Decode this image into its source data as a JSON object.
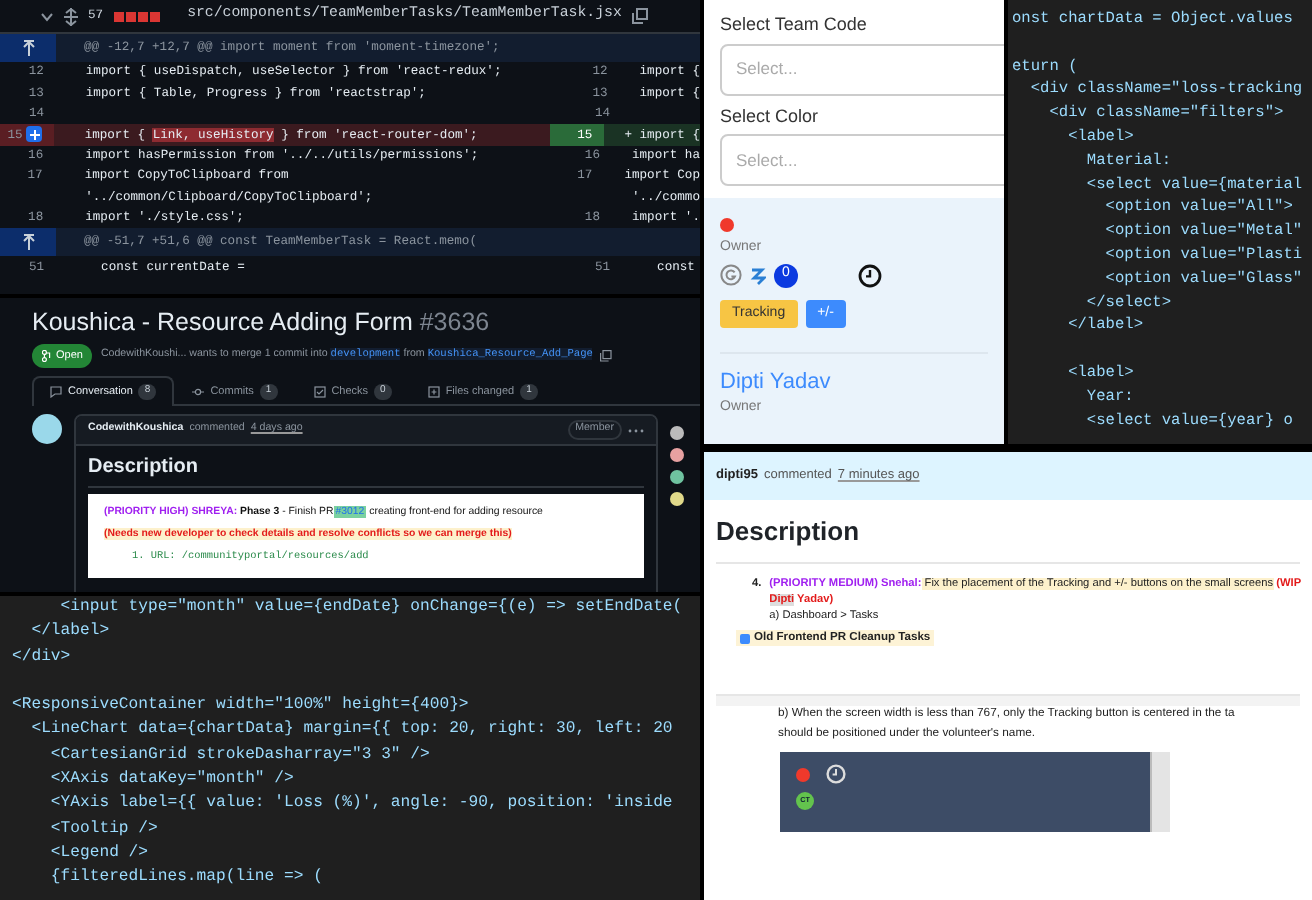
{
  "diff_panel": {
    "file": {
      "changes": "57",
      "path": "src/components/TeamMemberTasks/TeamMemberTask.jsx"
    },
    "rows": [
      {
        "kind": "hunk",
        "text": "@@ -12,7 +12,7 @@ import moment from 'moment-timezone';"
      },
      {
        "kind": "context",
        "left_num": "12",
        "left_code": "import { useDispatch, useSelector } from 'react-redux';",
        "right_num": "12",
        "right_code": "import {"
      },
      {
        "kind": "context",
        "left_num": "13",
        "left_code": "import { Table, Progress } from 'reactstrap';",
        "right_num": "13",
        "right_code": "import {"
      },
      {
        "kind": "context",
        "left_num": "14",
        "right_num": "14"
      },
      {
        "kind": "change",
        "left_num": "15",
        "left_segments": [
          {
            "text": "import { ",
            "removed": false
          },
          {
            "text": "Link, useHistory",
            "removed": true
          },
          {
            "text": " } from 'react-router-dom';",
            "removed": false
          }
        ],
        "right_num": "15",
        "right_code": "+ import {"
      },
      {
        "kind": "context",
        "left_num": "16",
        "left_code": "import hasPermission from '../../utils/permissions';",
        "right_num": "16",
        "right_code": "import ha"
      },
      {
        "kind": "context",
        "left_num": "17",
        "left_code": "import CopyToClipboard from",
        "right_num": "17",
        "right_code": "import Cop"
      },
      {
        "kind": "context",
        "left_code": "'../common/Clipboard/CopyToClipboard';",
        "right_code": "'../commo"
      },
      {
        "kind": "context",
        "left_num": "18",
        "left_code": "import './style.css';",
        "right_num": "18",
        "right_code": "import '."
      },
      {
        "kind": "hunk",
        "text": "@@ -51,7 +51,6 @@ const TeamMemberTask = React.memo("
      },
      {
        "kind": "context",
        "left_num": "51",
        "left_code": "  const currentDate =",
        "right_num": "51",
        "right_code": "  const"
      }
    ]
  },
  "pr_panel": {
    "title": "Koushica - Resource Adding Form",
    "number": "#3636",
    "state": "Open",
    "meta": [
      {
        "text": "CodewithKoushi... wants to merge 1 commit into ",
        "kind": "plain"
      },
      {
        "text": "development",
        "kind": "branch"
      },
      {
        "text": " from ",
        "kind": "plain"
      },
      {
        "text": "Koushica_Resource_Add_Page",
        "kind": "branch"
      }
    ],
    "tabs": [
      {
        "label": "Conversation",
        "count": "8",
        "selected": true
      },
      {
        "label": "Commits",
        "count": "1",
        "selected": false
      },
      {
        "label": "Checks",
        "count": "0",
        "selected": false
      },
      {
        "label": "Files changed",
        "count": "1",
        "selected": false
      }
    ],
    "comment": {
      "author": "CodewithKoushica",
      "action": "commented",
      "time": "4 days ago",
      "role": "Member",
      "heading": "Description",
      "lines": [
        {
          "kind": "paragraph",
          "segments": [
            {
              "text": "(PRIORITY HIGH) SHREYA:",
              "kind": "tag"
            },
            {
              "text": " Phase 3",
              "kind": "bold"
            },
            {
              "text": " - Finish PR",
              "kind": "plain"
            },
            {
              "text": "#3012",
              "kind": "link"
            },
            {
              "text": " creating front-end for adding resource",
              "kind": "plain"
            }
          ]
        },
        {
          "kind": "paragraph",
          "segments": [
            {
              "text": "(Needs new developer to check details and resolve conflicts so we can merge this)",
              "kind": "note"
            }
          ]
        },
        {
          "kind": "url",
          "number": "1.",
          "text": "URL: /communityportal/resources/add"
        }
      ]
    }
  },
  "code_panel": {
    "lines": [
      {
        "kind": "code",
        "text": "     <input type=\"month\" value={endDate} onChange={(e) => setEndDate("
      },
      {
        "kind": "code",
        "text": "  </label>"
      },
      {
        "kind": "code",
        "text": "</div>"
      },
      {
        "kind": "blank"
      },
      {
        "kind": "code",
        "text": "<ResponsiveContainer width=\"100%\" height={400}>"
      },
      {
        "kind": "code",
        "text": "  <LineChart data={chartData} margin={{ top: 20, right: 30, left: 20"
      },
      {
        "kind": "code",
        "text": "    <CartesianGrid strokeDasharray=\"3 3\" />"
      },
      {
        "kind": "code",
        "text": "    <XAxis dataKey=\"month\" />"
      },
      {
        "kind": "code",
        "text": "    <YAxis label={{ value: 'Loss (%)', angle: -90, position: 'inside"
      },
      {
        "kind": "code",
        "text": "    <Tooltip />"
      },
      {
        "kind": "code",
        "text": "    <Legend />"
      },
      {
        "kind": "code",
        "text": "    {filteredLines.map(line => ("
      }
    ]
  },
  "form_panel": {
    "fields": [
      {
        "label": "Select Team Code",
        "placeholder": "Select..."
      },
      {
        "label": "Select Color",
        "placeholder": "Select..."
      }
    ],
    "task": {
      "role": "Owner",
      "count": "0",
      "buttons": [
        {
          "label": "Tracking",
          "kind": "warning"
        },
        {
          "label": "+/-",
          "kind": "primary"
        }
      ]
    },
    "next_member": {
      "name": "Dipti Yadav",
      "role": "Owner"
    }
  },
  "code_panel_2": {
    "lines": [
      {
        "kind": "code",
        "text": "onst chartData = Object.values"
      },
      {
        "kind": "blank"
      },
      {
        "kind": "code",
        "text": "eturn ("
      },
      {
        "kind": "code",
        "text": "  <div className=\"loss-tracking"
      },
      {
        "kind": "code",
        "text": "    <div className=\"filters\">"
      },
      {
        "kind": "code",
        "text": "      <label>"
      },
      {
        "kind": "code",
        "text": "        Material:"
      },
      {
        "kind": "code",
        "text": "        <select value={material"
      },
      {
        "kind": "code",
        "text": "          <option value=\"All\">"
      },
      {
        "kind": "code",
        "text": "          <option value=\"Metal\""
      },
      {
        "kind": "code",
        "text": "          <option value=\"Plasti"
      },
      {
        "kind": "code",
        "text": "          <option value=\"Glass\""
      },
      {
        "kind": "code",
        "text": "        </select>"
      },
      {
        "kind": "code",
        "text": "      </label>"
      },
      {
        "kind": "blank"
      },
      {
        "kind": "code",
        "text": "      <label>"
      },
      {
        "kind": "code",
        "text": "        Year:"
      },
      {
        "kind": "code",
        "text": "        <select value={year} o"
      }
    ]
  },
  "doc_panel": {
    "comment": {
      "author": "dipti95",
      "action": "commented",
      "time": "7 minutes ago"
    },
    "heading": "Description",
    "item": {
      "number": "4.",
      "segments": [
        {
          "text": "(PRIORITY MEDIUM) Snehal:",
          "kind": "tag"
        },
        {
          "text": " Fix the placement of the Tracking and +/- buttons on the small screens",
          "kind": "highlight"
        },
        {
          "text": " (WIP ",
          "kind": "alert"
        },
        {
          "text": "Dipti",
          "kind": "mention"
        },
        {
          "text": " Yadav)",
          "kind": "alert"
        }
      ],
      "sub": "a) Dashboard > Tasks"
    },
    "task": {
      "checked": true,
      "text": "Old Frontend PR Cleanup Tasks"
    },
    "note_lines": [
      "b) When the screen width is less than 767, only the Tracking button is centered in the ta",
      "should be positioned under the volunteer's name."
    ],
    "preview": {
      "avatar": "CT"
    }
  }
}
